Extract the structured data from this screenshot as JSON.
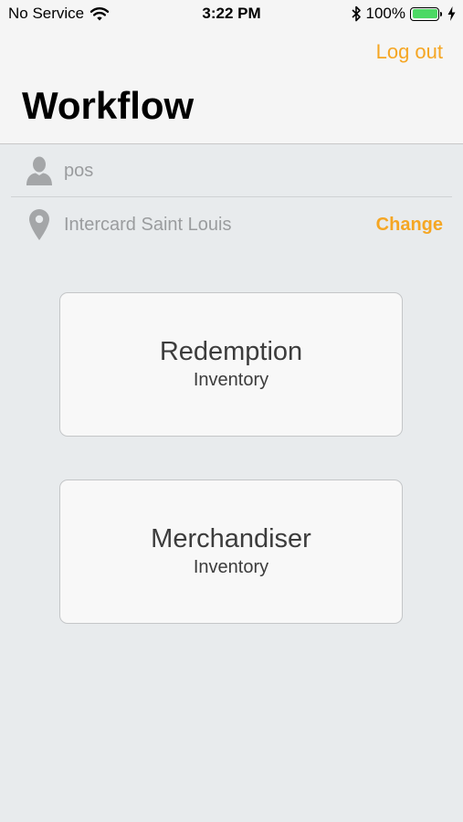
{
  "status_bar": {
    "carrier": "No Service",
    "time": "3:22 PM",
    "battery": "100%"
  },
  "header": {
    "logout_label": "Log out",
    "title": "Workflow"
  },
  "user": {
    "name": "pos"
  },
  "location": {
    "name": "Intercard Saint Louis",
    "change_label": "Change"
  },
  "workflows": [
    {
      "title": "Redemption",
      "subtitle": "Inventory"
    },
    {
      "title": "Merchandiser",
      "subtitle": "Inventory"
    }
  ],
  "colors": {
    "accent": "#f5a623",
    "battery": "#4cd964",
    "background": "#e8ebed"
  }
}
